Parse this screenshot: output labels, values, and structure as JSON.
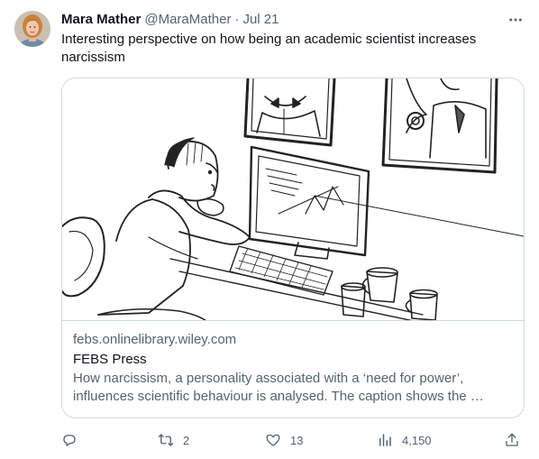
{
  "tweet": {
    "author_name": "Mara Mather",
    "author_handle": "@MaraMather",
    "separator": "·",
    "date": "Jul 21",
    "text": "Interesting perspective on how being an academic scientist increases narcissism"
  },
  "card": {
    "domain": "febs.onlinelibrary.wiley.com",
    "title": "FEBS Press",
    "description": "How narcissism, a personality associated with a ‘need for power’, influences scientific behaviour is analysed. The caption shows the …"
  },
  "actions": {
    "replies": "",
    "retweets": "2",
    "likes": "13",
    "views": "4,150"
  },
  "icons": {
    "more": "more-horizontal-icon",
    "reply": "reply-icon",
    "retweet": "retweet-icon",
    "like": "heart-icon",
    "views": "bar-chart-icon",
    "share": "share-icon"
  },
  "colors": {
    "text_primary": "#0f1419",
    "text_secondary": "#536471",
    "border": "#cfd9de"
  }
}
